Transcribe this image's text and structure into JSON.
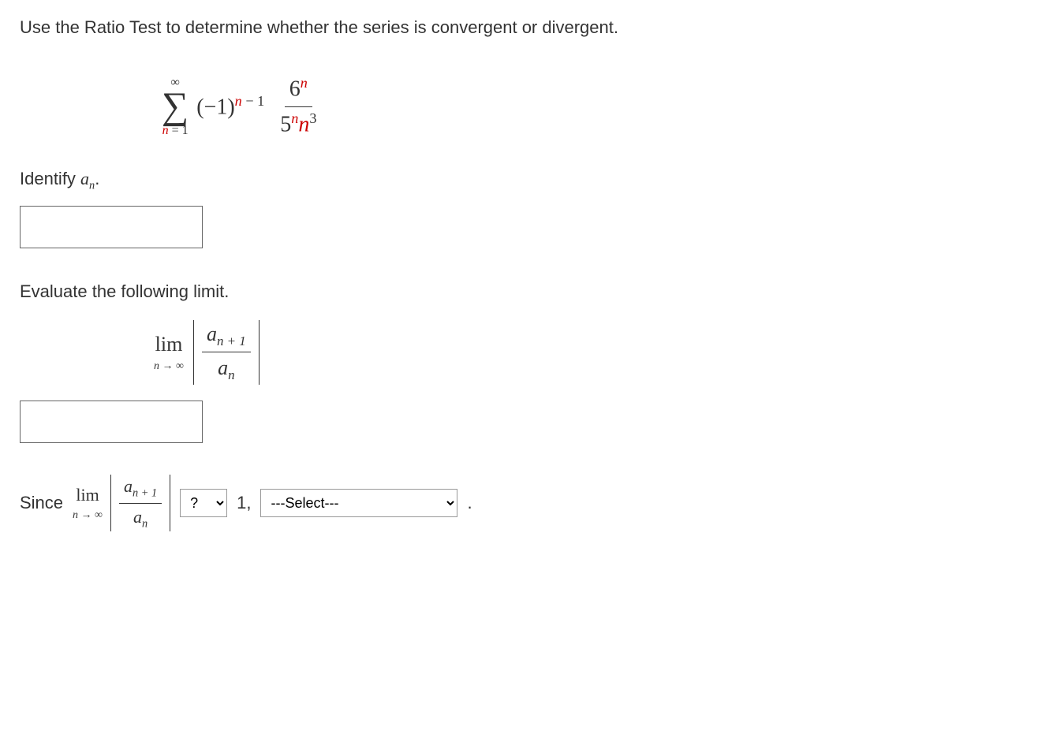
{
  "question": "Use the Ratio Test to determine whether the series is convergent or divergent.",
  "series": {
    "sigma_top": "∞",
    "sigma_bottom_var": "n",
    "sigma_bottom_eq": " = 1",
    "base": "(−1)",
    "exponent_var": "n",
    "exponent_minus": " − 1",
    "numerator_base": "6",
    "numerator_exp": "n",
    "denominator_base": "5",
    "denominator_exp": "n",
    "denominator_var": "n",
    "denominator_pow": "3"
  },
  "identify_label_pre": "Identify ",
  "identify_var": "a",
  "identify_sub": "n",
  "identify_label_post": ".",
  "evaluate_label": "Evaluate the following limit.",
  "limit": {
    "lim": "lim",
    "under_var": "n",
    "under_arrow": " → ∞",
    "ratio_top_var": "a",
    "ratio_top_sub": "n + 1",
    "ratio_bot_var": "a",
    "ratio_bot_sub": "n"
  },
  "final": {
    "since": "Since ",
    "one_comma": "1,",
    "period": "."
  },
  "dropdowns": {
    "relation_placeholder": "?",
    "conclusion_placeholder": "---Select---"
  }
}
